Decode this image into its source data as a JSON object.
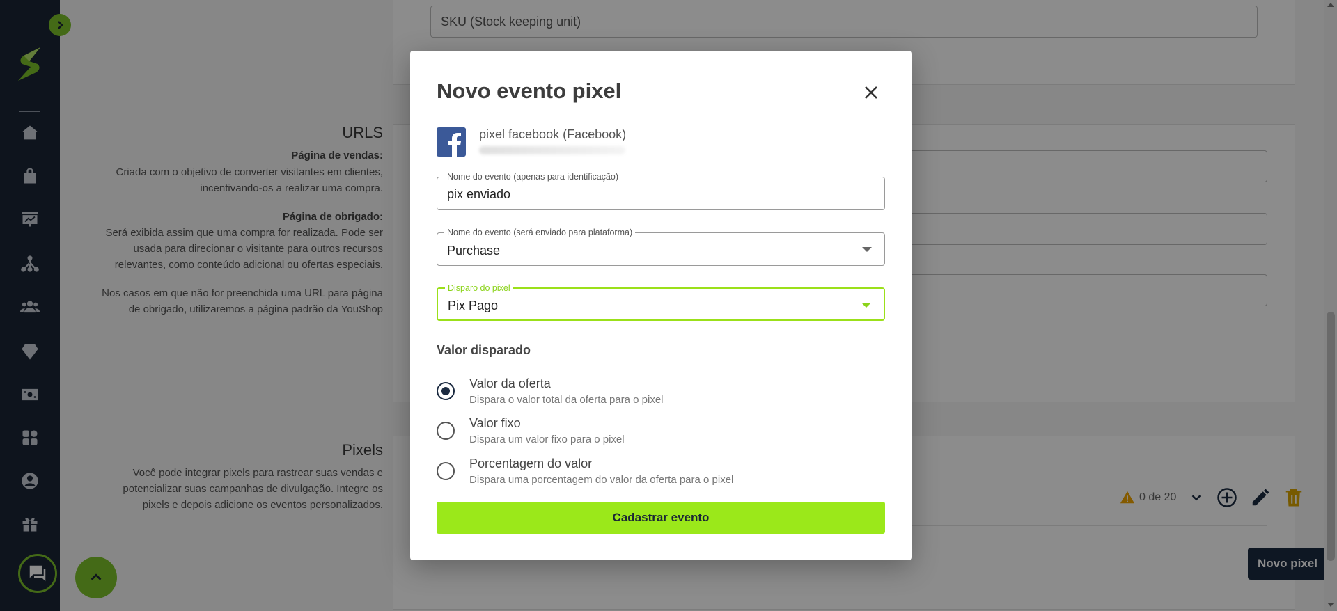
{
  "background": {
    "sku_placeholder": "SKU (Stock keeping unit)",
    "urls": {
      "title": "URLS",
      "sales_label": "Página de vendas:",
      "sales_text_1": "Criada com o objetivo de converter visitantes em clientes,",
      "sales_text_2": "incentivando-os a realizar uma compra.",
      "thanks_label": "Página de obrigado:",
      "thanks_text_1": "Será exibida assim que uma compra for realizada. Pode ser",
      "thanks_text_2": "usada para direcionar o visitante para outros recursos",
      "thanks_text_3": "relevantes, como conteúdo adicional ou ofertas especiais.",
      "note_1": "Nos casos em que não for preenchida uma URL para página",
      "note_2": "de obrigado, utilizaremos a página padrão da YouShop"
    },
    "pixels": {
      "title": "Pixels",
      "text_1": "Você pode integrar pixels para rastrear suas vendas e",
      "text_2": "potencializar suas campanhas de divulgação. Integre os",
      "text_3": "pixels e depois adicione os eventos personalizados.",
      "count": "0 de 20",
      "new_pixel_label": "Novo pixel"
    }
  },
  "modal": {
    "title": "Novo evento pixel",
    "pixel_name": "pixel facebook (Facebook)",
    "event_name_label": "Nome do evento (apenas para identificação)",
    "event_name_value": "pix enviado",
    "platform_event_label": "Nome do evento (será enviado para plataforma)",
    "platform_event_value": "Purchase",
    "trigger_label": "Disparo do pixel",
    "trigger_value": "Pix Pago",
    "value_section_label": "Valor disparado",
    "options": [
      {
        "title": "Valor da oferta",
        "desc": "Dispara o valor total da oferta para o pixel",
        "checked": true
      },
      {
        "title": "Valor fixo",
        "desc": "Dispara um valor fixo para o pixel",
        "checked": false
      },
      {
        "title": "Porcentagem do valor",
        "desc": "Dispara uma porcentagem do valor da oferta para o pixel",
        "checked": false
      }
    ],
    "submit_label": "Cadastrar evento"
  },
  "colors": {
    "sidebar": "#1b2636",
    "accent_green": "#9be81a",
    "dark_button": "#1b2a40",
    "facebook_blue": "#3b5998"
  },
  "icons": {
    "sidebar": [
      "home-icon",
      "shopping-bag-icon",
      "chart-board-icon",
      "network-icon",
      "users-icon",
      "diamond-icon",
      "money-icon",
      "apps-icon",
      "user-circle-icon",
      "gift-icon"
    ]
  }
}
